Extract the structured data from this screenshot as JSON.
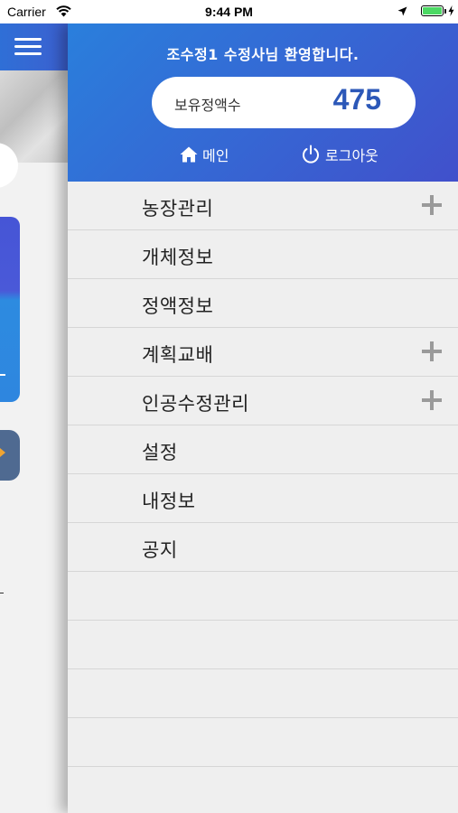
{
  "status_bar": {
    "carrier": "Carrier",
    "time": "9:44 PM"
  },
  "drawer": {
    "welcome": "조수정1 수정사님 환영합니다.",
    "balance_label": "보유정액수",
    "balance_value": "475",
    "main_link": "메인",
    "logout_link": "로그아웃"
  },
  "menu": {
    "items": [
      {
        "label": "농장관리",
        "expandable": true
      },
      {
        "label": "개체정보",
        "expandable": false
      },
      {
        "label": "정액정보",
        "expandable": false
      },
      {
        "label": "계획교배",
        "expandable": true
      },
      {
        "label": "인공수정관리",
        "expandable": true
      },
      {
        "label": "설정",
        "expandable": false
      },
      {
        "label": "내정보",
        "expandable": false
      },
      {
        "label": "공지",
        "expandable": false
      }
    ]
  },
  "colors": {
    "header_gradient_start": "#2a7fdc",
    "header_gradient_end": "#4150cb",
    "balance_value": "#2c58b8",
    "plus_icon": "#9a9a9a"
  },
  "icons": [
    "menu-icon",
    "wifi-icon",
    "location-icon",
    "battery-icon",
    "home-icon",
    "power-icon",
    "plus-icon"
  ]
}
